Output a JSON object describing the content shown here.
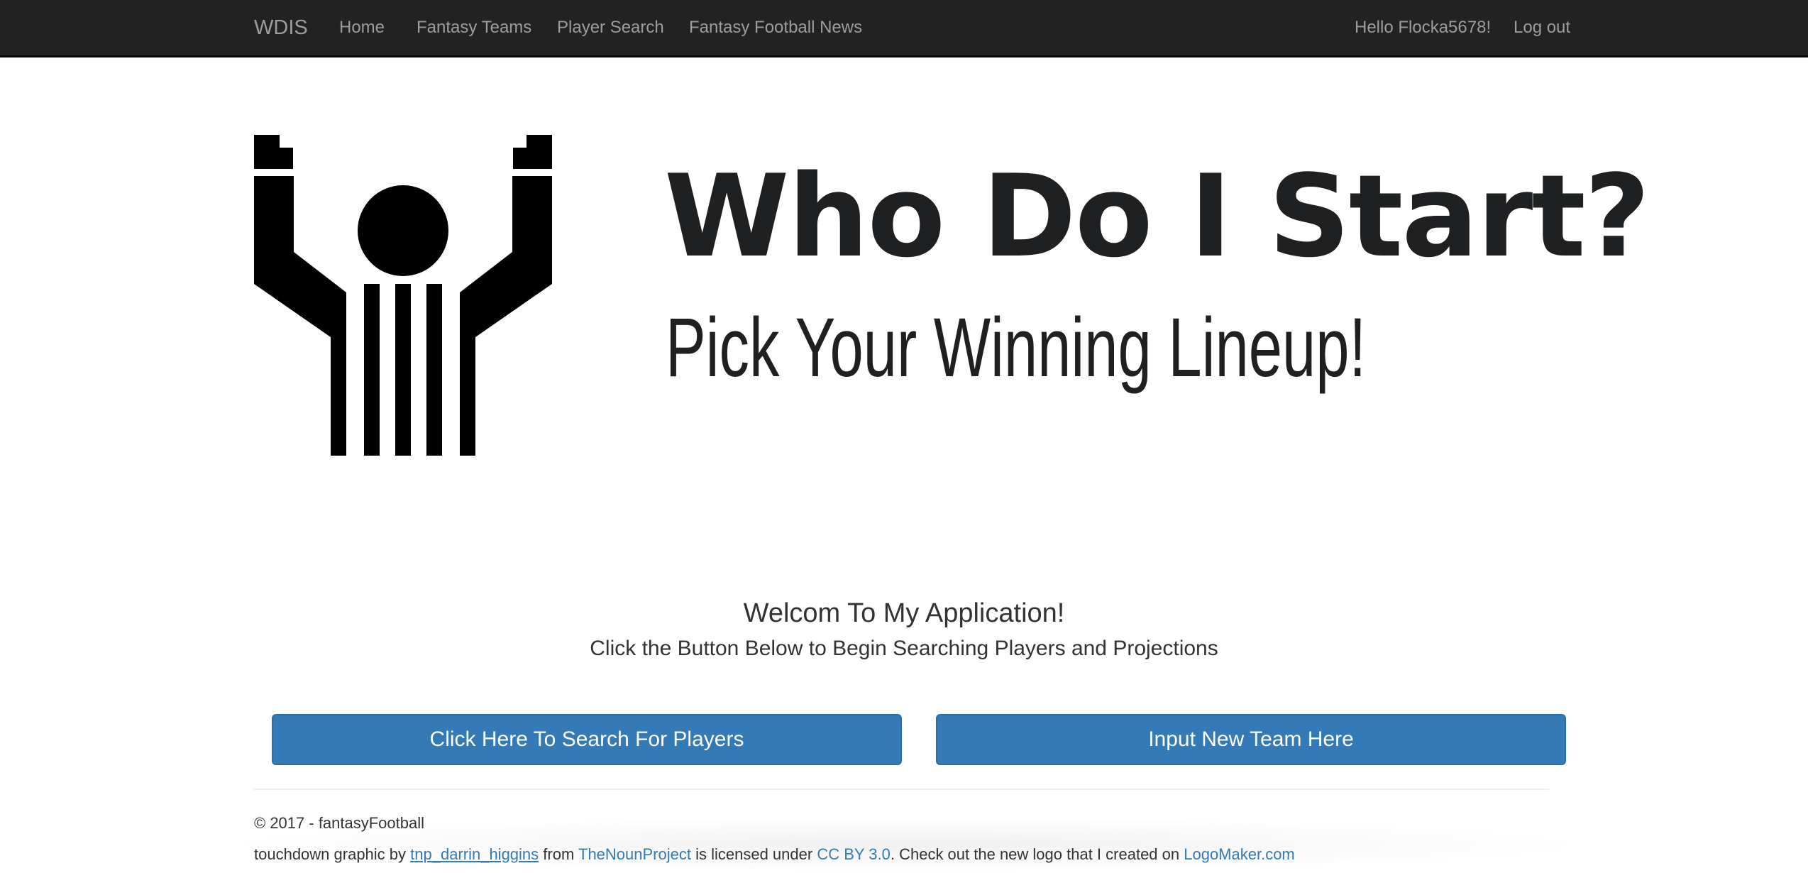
{
  "navbar": {
    "brand": "WDIS",
    "links": [
      "Home",
      "Fantasy Teams",
      "Player Search",
      "Fantasy Football News"
    ],
    "greeting": "Hello Flocka5678!",
    "logout": "Log out",
    "background": "#222222",
    "link_color": "#9d9d9d"
  },
  "hero": {
    "logo_icon": "referee-touchdown-icon",
    "title": "Who Do I Start?",
    "subtitle": "Pick Your Winning Lineup!"
  },
  "welcome": {
    "heading": "Welcom To My Application!",
    "subheading": "Click the Button Below to Begin Searching Players and Projections"
  },
  "buttons": {
    "search_players": "Click Here To Search For Players",
    "input_team": "Input New Team Here",
    "color": "#337ab7"
  },
  "footer": {
    "copyright": "© 2017 - fantasyFootball",
    "credit_prefix": "touchdown graphic by ",
    "credit_author": "tnp_darrin_higgins",
    "credit_from": " from ",
    "credit_source": "TheNounProject",
    "credit_license_text": " is licensed under ",
    "credit_license": "CC BY 3.0",
    "credit_logo_text": ". Check out the new logo that I created on ",
    "credit_logo_site": "LogoMaker.com"
  }
}
